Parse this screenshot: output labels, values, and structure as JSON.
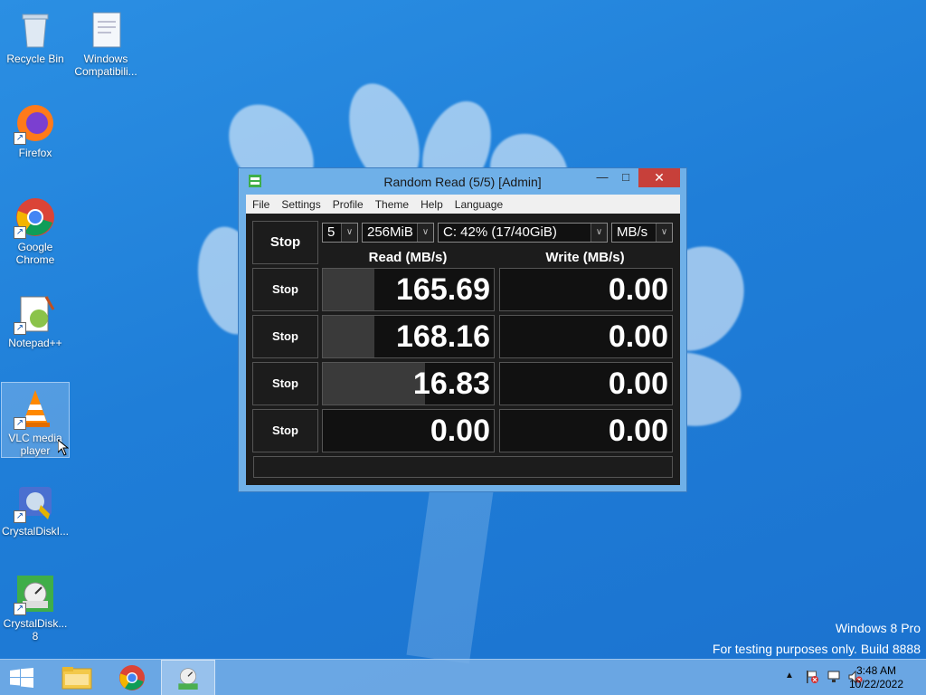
{
  "desktop": {
    "icons": [
      {
        "label": "Recycle Bin",
        "icon": "recycle-bin-icon"
      },
      {
        "label": "Windows Compatibili...",
        "icon": "windows-compat-icon"
      },
      {
        "label": "Firefox",
        "icon": "firefox-icon"
      },
      {
        "label": "Google Chrome",
        "icon": "chrome-icon"
      },
      {
        "label": "Notepad++",
        "icon": "notepadpp-icon"
      },
      {
        "label": "VLC media player",
        "icon": "vlc-icon"
      },
      {
        "label": "CrystalDiskI...",
        "icon": "crystaldiskinfo-icon"
      },
      {
        "label": "CrystalDisk... 8",
        "icon": "crystaldiskmark-icon"
      }
    ],
    "watermark": {
      "edition": "Windows 8 Pro",
      "build": "For testing purposes only. Build 8888"
    }
  },
  "window": {
    "title": "Random Read (5/5) [Admin]",
    "menu": [
      "File",
      "Settings",
      "Profile",
      "Theme",
      "Help",
      "Language"
    ],
    "controls": {
      "all_button": "Stop",
      "count": "5",
      "size": "256MiB",
      "drive": "C: 42% (17/40GiB)",
      "unit": "MB/s"
    },
    "headers": {
      "read": "Read (MB/s)",
      "write": "Write (MB/s)"
    },
    "rows": [
      {
        "button": "Stop",
        "read": "165.69",
        "write": "0.00",
        "read_fill": 0.3
      },
      {
        "button": "Stop",
        "read": "168.16",
        "write": "0.00",
        "read_fill": 0.3
      },
      {
        "button": "Stop",
        "read": "16.83",
        "write": "0.00",
        "read_fill": 0.6
      },
      {
        "button": "Stop",
        "read": "0.00",
        "write": "0.00",
        "read_fill": 0
      }
    ],
    "status": ""
  },
  "taskbar": {
    "items": [
      "start-button",
      "file-explorer",
      "google-chrome",
      "crystaldiskmark"
    ],
    "clock": {
      "time": "3:48 AM",
      "date": "10/22/2022"
    }
  },
  "colors": {
    "accent": "#c7403a",
    "window_frame": "#6fb0e8",
    "panel": "#1c1c1c"
  }
}
